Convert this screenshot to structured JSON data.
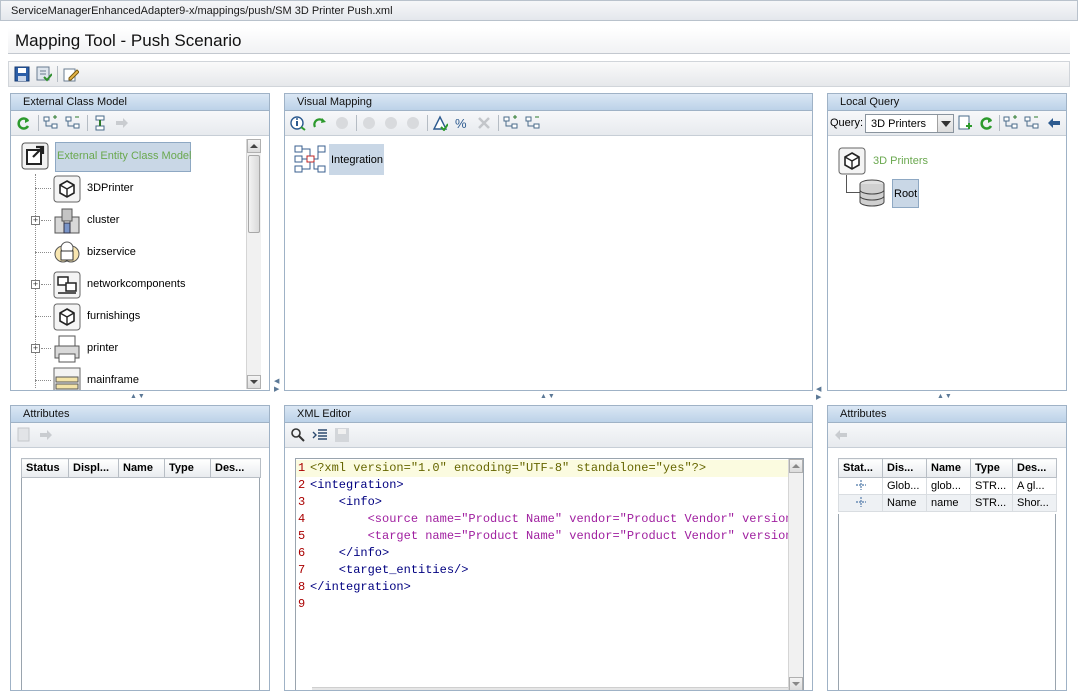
{
  "window": {
    "path": "ServiceManagerEnhancedAdapter9-x/mappings/push/SM 3D Printer Push.xml"
  },
  "page": {
    "title": "Mapping Tool - Push Scenario"
  },
  "main_toolbar": {
    "icons": [
      "save-icon",
      "save-deploy-icon",
      "edit-icon"
    ]
  },
  "external_class_model": {
    "header": "External Class Model",
    "root_label": "External Entity Class Model",
    "items": [
      {
        "label": "3DPrinter",
        "icon": "cube-icon",
        "expandable": false
      },
      {
        "label": "cluster",
        "icon": "cluster-icon",
        "expandable": true
      },
      {
        "label": "bizservice",
        "icon": "service-icon",
        "expandable": false
      },
      {
        "label": "networkcomponents",
        "icon": "network-icon",
        "expandable": true
      },
      {
        "label": "furnishings",
        "icon": "cube-icon",
        "expandable": false
      },
      {
        "label": "printer",
        "icon": "printer-icon",
        "expandable": true
      },
      {
        "label": "mainframe",
        "icon": "mainframe-icon",
        "expandable": false
      }
    ]
  },
  "visual_mapping": {
    "header": "Visual Mapping",
    "node_label": "Integration"
  },
  "local_query": {
    "header": "Local Query",
    "query_label": "Query:",
    "query_value": "3D Printers",
    "root_label": "3D Printers",
    "child_label": "Root"
  },
  "left_attributes": {
    "header": "Attributes",
    "columns": [
      "Status",
      "Displ...",
      "Name",
      "Type",
      "Des..."
    ]
  },
  "xml_editor": {
    "header": "XML Editor",
    "lines": [
      {
        "num": "1",
        "text": "<?xml version=\"1.0\" encoding=\"UTF-8\" standalone=\"yes\"?>"
      },
      {
        "num": "2",
        "text": "<integration>"
      },
      {
        "num": "3",
        "text": "    <info>"
      },
      {
        "num": "4",
        "text": "        <source name=\"Product Name\" vendor=\"Product Vendor\" version="
      },
      {
        "num": "5",
        "text": "        <target name=\"Product Name\" vendor=\"Product Vendor\" version="
      },
      {
        "num": "6",
        "text": "    </info>"
      },
      {
        "num": "7",
        "text": "    <target_entities/>"
      },
      {
        "num": "8",
        "text": "</integration>"
      },
      {
        "num": "9",
        "text": ""
      }
    ]
  },
  "right_attributes": {
    "header": "Attributes",
    "columns": [
      "Stat...",
      "Dis...",
      "Name",
      "Type",
      "Des..."
    ],
    "rows": [
      {
        "display": "Glob...",
        "name": "glob...",
        "type": "STR...",
        "desc": "A gl..."
      },
      {
        "display": "Name",
        "name": "name",
        "type": "STR...",
        "desc": "Shor..."
      }
    ]
  }
}
